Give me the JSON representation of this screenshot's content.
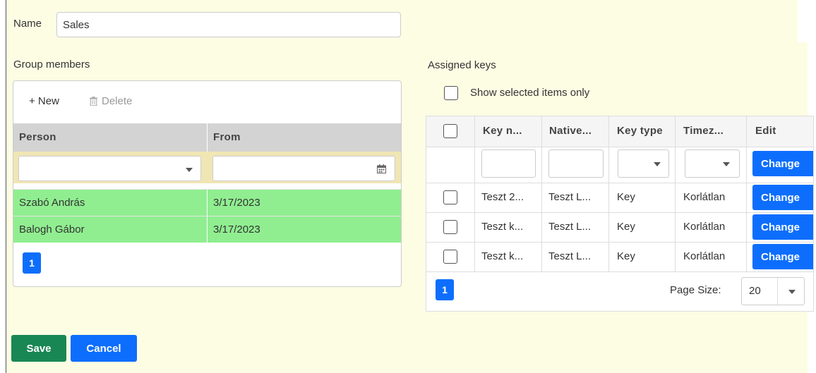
{
  "form": {
    "name_label": "Name",
    "name_value": "Sales",
    "save_label": "Save",
    "cancel_label": "Cancel"
  },
  "group_members": {
    "title": "Group members",
    "toolbar": {
      "new_label": "+ New",
      "delete_label": "Delete"
    },
    "columns": [
      "Person",
      "From"
    ],
    "rows": [
      {
        "person": "Szabó András",
        "from": "3/17/2023"
      },
      {
        "person": "Balogh Gábor",
        "from": "3/17/2023"
      }
    ],
    "page": "1",
    "row_color": "#90ee90"
  },
  "assigned_keys": {
    "title": "Assigned keys",
    "show_selected_label": "Show selected items only",
    "columns": [
      "Key n...",
      "Native...",
      "Key type",
      "Timez...",
      "Edit"
    ],
    "change_label": "Change",
    "rows": [
      {
        "key_name": "Teszt 2...",
        "native": "Teszt L...",
        "key_type": "Key",
        "timezone": "Korlátlan"
      },
      {
        "key_name": "Teszt k...",
        "native": "Teszt L...",
        "key_type": "Key",
        "timezone": "Korlátlan"
      },
      {
        "key_name": "Teszt k...",
        "native": "Teszt L...",
        "key_type": "Key",
        "timezone": "Korlátlan"
      }
    ],
    "page": "1",
    "page_size_label": "Page Size:",
    "page_size_value": "20"
  },
  "colors": {
    "accent_blue": "#0d6efd",
    "save_green": "#198754",
    "background": "#fdfde4"
  }
}
